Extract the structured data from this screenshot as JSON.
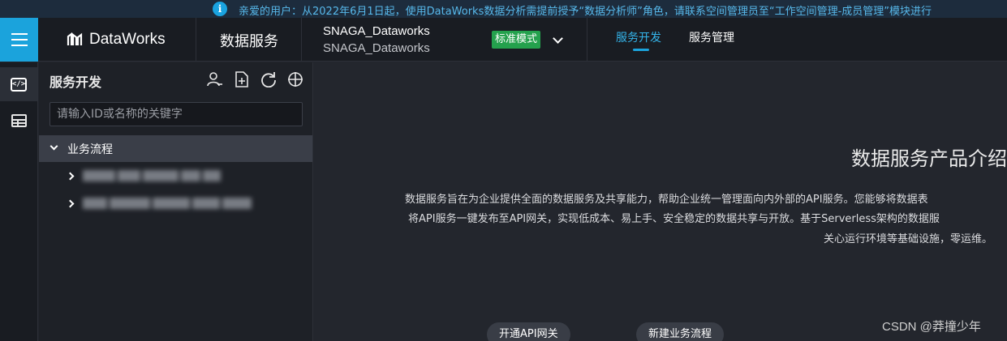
{
  "notice": {
    "icon": "info-icon",
    "text": "亲爱的用户：从2022年6月1日起，使用DataWorks数据分析需提前授予“数据分析师”角色，请联系空间管理员至“工作空间管理-成员管理”模块进行"
  },
  "header": {
    "logo_text": "DataWorks",
    "module_title": "数据服务",
    "workspace_name": "SNAGA_Dataworks",
    "workspace_sub": "SNAGA_Dataworks",
    "mode_badge": "标准模式",
    "tabs": [
      {
        "label": "服务开发",
        "active": true
      },
      {
        "label": "服务管理",
        "active": false
      }
    ]
  },
  "rail": {
    "items": [
      {
        "icon": "code-icon",
        "active": true
      },
      {
        "icon": "table-icon",
        "active": false
      }
    ]
  },
  "panel": {
    "title": "服务开发",
    "icons": [
      "user-icon",
      "new-file-icon",
      "refresh-icon",
      "locate-icon"
    ],
    "search_placeholder": "请输入ID或名称的关键字",
    "tree_root": "业务流程"
  },
  "main": {
    "intro_title": "数据服务产品介绍",
    "intro_lines": [
      "数据服务旨在为企业提供全面的数据服务及共享能力，帮助企业统一管理面向内外部的API服务。您能够将数据表",
      "将API服务一键发布至API网关，实现低成本、易上手、安全稳定的数据共享与开放。基于Serverless架构的数据服",
      "关心运行环境等基础设施，零运维。"
    ],
    "buttons": [
      "开通API网关",
      "新建业务流程"
    ]
  },
  "watermark": "CSDN @莽撞少年",
  "colors": {
    "accent": "#1ba3dc",
    "badge_green": "#24a14d",
    "notice_text": "#57b8ea"
  }
}
